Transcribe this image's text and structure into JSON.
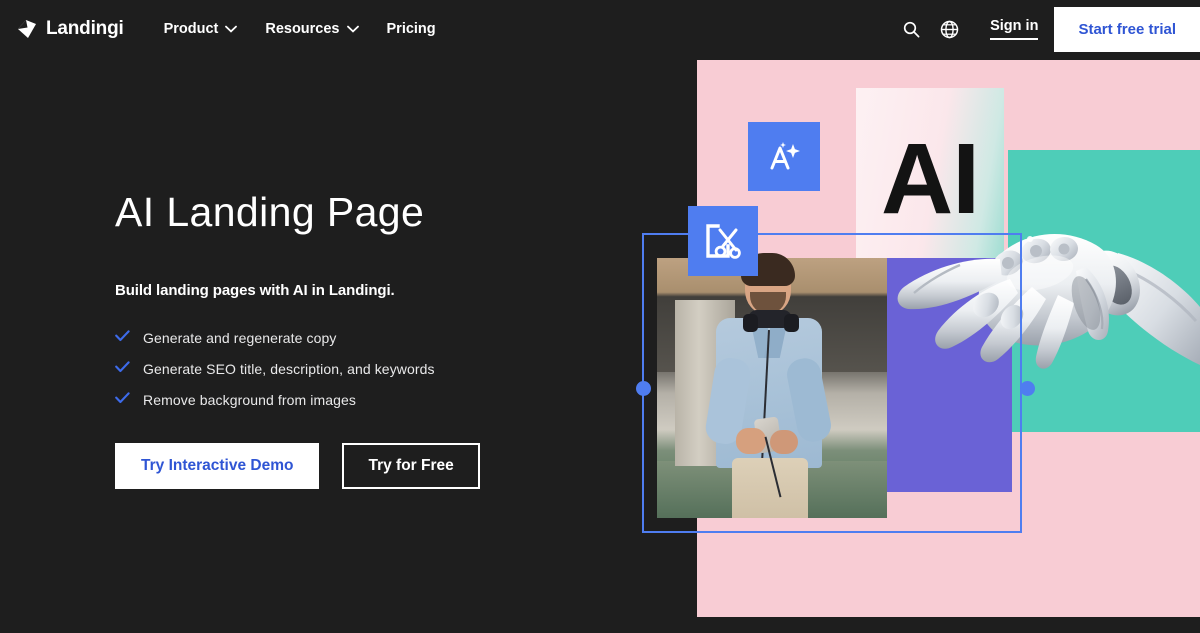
{
  "nav": {
    "logo_text": "Landingi",
    "logo_icon": "diamond-logo-icon",
    "links": [
      {
        "label": "Product",
        "has_dropdown": true,
        "icon": "chevron-down-icon"
      },
      {
        "label": "Resources",
        "has_dropdown": true,
        "icon": "chevron-down-icon"
      },
      {
        "label": "Pricing",
        "has_dropdown": false,
        "icon": ""
      }
    ],
    "search_icon": "search-icon",
    "language_icon": "globe-icon",
    "signin_label": "Sign in",
    "trial_label": "Start free trial"
  },
  "hero": {
    "title": "AI Landing Page",
    "subtitle": "Build landing pages with AI in Landingi.",
    "features": [
      {
        "icon": "check-icon",
        "text": "Generate and regenerate copy"
      },
      {
        "icon": "check-icon",
        "text": "Generate SEO title, description, and keywords"
      },
      {
        "icon": "check-icon",
        "text": "Remove background from images"
      }
    ],
    "primary_cta": "Try Interactive Demo",
    "secondary_cta": "Try for Free"
  },
  "collage": {
    "ai_card_text": "AI",
    "badges": [
      {
        "name": "magic-text-icon",
        "alt": "A with sparkles"
      },
      {
        "name": "remove-background-scissors-icon",
        "alt": "crop frame with scissors"
      }
    ],
    "photo_alt": "man-with-headphones-holding-phone",
    "robot_alt": "robotic-hand",
    "selection_frame": "image-selection-frame",
    "handles": [
      "resize-handle-left",
      "resize-handle-right"
    ]
  },
  "colors": {
    "background": "#1e1e1e",
    "accent_blue": "#2f55d4",
    "handle_blue": "#4f7df0",
    "pink": "#f8ccd4",
    "teal": "#4ecdb8",
    "purple": "#6a62d6",
    "white": "#ffffff"
  }
}
